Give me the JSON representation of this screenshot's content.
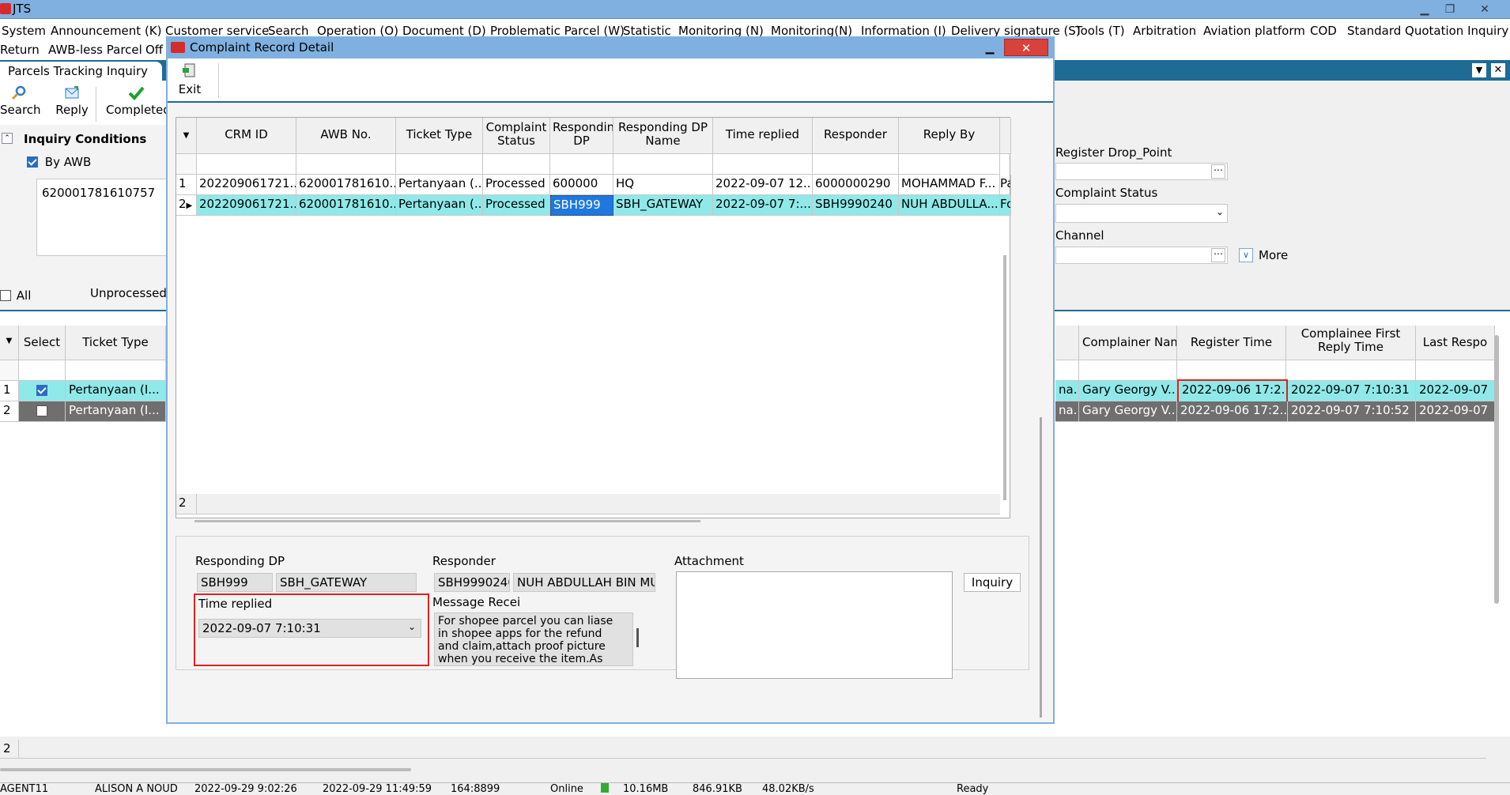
{
  "app": {
    "title": "JTS"
  },
  "menu": [
    "System",
    "Announcement (K)",
    "Customer service",
    "Search",
    "Operation (O)",
    "Document (D)",
    "Problematic Parcel (W)",
    "Statistic",
    "Monitoring (N)",
    "Monitoring(N)",
    "Information (I)",
    "Delivery signature (S)",
    "Tools (T)",
    "Arbitration",
    "Aviation platform",
    "COD",
    "Standard Quotation Inquiry"
  ],
  "menu2": [
    "Return",
    "AWB-less Parcel",
    "Off"
  ],
  "tab": {
    "label": "Parcels Tracking Inquiry"
  },
  "toolbar": {
    "search": "Search",
    "reply": "Reply",
    "completed": "Completed"
  },
  "inquiry": {
    "title": "Inquiry Conditions",
    "by_awb": "By AWB",
    "awb_value": "620001781610757",
    "all_label": "All",
    "unprocessed_label": "Unprocessed"
  },
  "right_panel": {
    "register_drop_point": "Register Drop_Point",
    "complaint_status": "Complaint Status",
    "channel": "Channel",
    "more": "More"
  },
  "main_grid": {
    "left_headers": [
      "Select",
      "Ticket Type"
    ],
    "right_headers": [
      "Complainer Name",
      "Register Time",
      "Complainee First Reply Time",
      "Last Respo"
    ],
    "rows": [
      {
        "num": "1",
        "checked": true,
        "ticket": "Pertanyaan (I...",
        "prefix": "na...",
        "complainer": "Gary Georgy V...",
        "register": "2022-09-06 17:2...",
        "first_reply": "2022-09-07 7:10:31",
        "last": "2022-09-07"
      },
      {
        "num": "2",
        "checked": false,
        "ticket": "Pertanyaan (I...",
        "prefix": "na...",
        "complainer": "Gary Georgy V...",
        "register": "2022-09-06 17:2...",
        "first_reply": "2022-09-07 7:10:52",
        "last": "2022-09-07"
      }
    ],
    "footer_count": "2"
  },
  "dialog": {
    "title": "Complaint Record Detail",
    "exit": "Exit",
    "grid": {
      "headers": [
        "CRM ID",
        "AWB No.",
        "Ticket Type",
        "Complaint Status",
        "Responding DP",
        "Responding DP Name",
        "Time replied",
        "Responder",
        "Reply By"
      ],
      "rows": [
        {
          "num": "1",
          "crm": "202209061721...",
          "awb": "620001781610...",
          "ticket": "Pertanyaan (...",
          "status": "Processed",
          "dp": "600000",
          "dp_name": "HQ",
          "time": "2022-09-07 12...",
          "responder": "6000000290",
          "reply_by": "MOHAMMAD F...",
          "extra": "Pa"
        },
        {
          "num": "2",
          "crm": "202209061721...",
          "awb": "620001781610...",
          "ticket": "Pertanyaan (...",
          "status": "Processed",
          "dp": "SBH999",
          "dp_name": "SBH_GATEWAY",
          "time": "2022-09-07 7:...",
          "responder": "SBH9990240",
          "reply_by": "NUH ABDULLA...",
          "extra": "Fo"
        }
      ],
      "footer_count": "2"
    },
    "detail": {
      "responding_dp_label": "Responding DP",
      "dp_code": "SBH999",
      "dp_name": "SBH_GATEWAY",
      "responder_label": "Responder",
      "responder_code": "SBH9990240",
      "responder_name": "NUH ABDULLAH BIN MUH",
      "attachment_label": "Attachment",
      "inquiry_button": "Inquiry",
      "time_replied_label": "Time replied",
      "time_replied_value": "2022-09-07 7:10:31",
      "message_label": "Message Recei",
      "message_text": "For shopee parcel you can liase in shopee apps for the refund and claim,attach proof picture  when you receive the item.As we need"
    }
  },
  "statusbar": [
    "AGENT11",
    "ALISON A NOUD",
    "2022-09-29 9:02:26",
    "2022-09-29 11:49:59",
    "164:8899",
    "Online",
    "10.16MB",
    "846.91KB",
    "48.02KB/s",
    "Ready"
  ]
}
